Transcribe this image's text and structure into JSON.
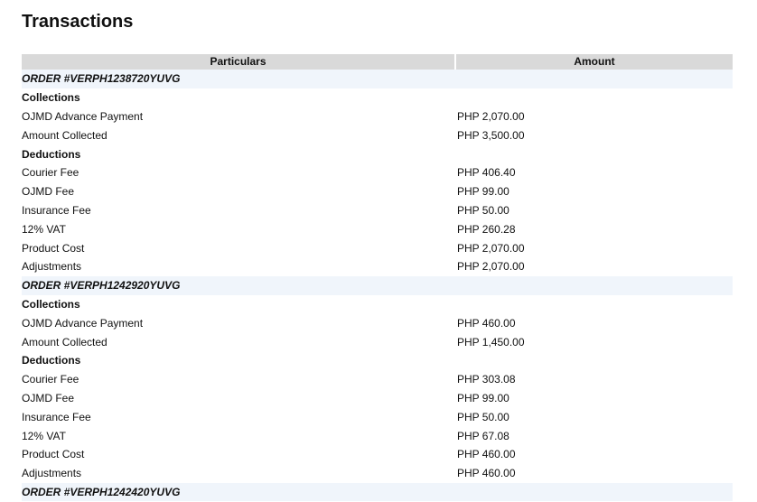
{
  "page": {
    "title": "Transactions"
  },
  "table": {
    "headers": {
      "particulars": "Particulars",
      "amount": "Amount"
    },
    "rows": [
      {
        "kind": "order",
        "label": "ORDER #VERPH1238720YUVG",
        "amount": ""
      },
      {
        "kind": "section",
        "label": "Collections",
        "amount": ""
      },
      {
        "kind": "item",
        "label": "OJMD Advance Payment",
        "amount": "PHP 2,070.00"
      },
      {
        "kind": "item",
        "label": "Amount Collected",
        "amount": "PHP 3,500.00"
      },
      {
        "kind": "section",
        "label": "Deductions",
        "amount": ""
      },
      {
        "kind": "item",
        "label": "Courier Fee",
        "amount": "PHP 406.40"
      },
      {
        "kind": "item",
        "label": "OJMD Fee",
        "amount": "PHP 99.00"
      },
      {
        "kind": "item",
        "label": "Insurance Fee",
        "amount": "PHP 50.00"
      },
      {
        "kind": "item",
        "label": "12% VAT",
        "amount": "PHP 260.28"
      },
      {
        "kind": "item",
        "label": "Product Cost",
        "amount": "PHP 2,070.00"
      },
      {
        "kind": "item",
        "label": "Adjustments",
        "amount": "PHP 2,070.00"
      },
      {
        "kind": "order",
        "label": "ORDER #VERPH1242920YUVG",
        "amount": ""
      },
      {
        "kind": "section",
        "label": "Collections",
        "amount": ""
      },
      {
        "kind": "item",
        "label": "OJMD Advance Payment",
        "amount": "PHP 460.00"
      },
      {
        "kind": "item",
        "label": "Amount Collected",
        "amount": "PHP 1,450.00"
      },
      {
        "kind": "section",
        "label": "Deductions",
        "amount": ""
      },
      {
        "kind": "item",
        "label": "Courier Fee",
        "amount": "PHP 303.08"
      },
      {
        "kind": "item",
        "label": "OJMD Fee",
        "amount": "PHP 99.00"
      },
      {
        "kind": "item",
        "label": "Insurance Fee",
        "amount": "PHP 50.00"
      },
      {
        "kind": "item",
        "label": "12% VAT",
        "amount": "PHP 67.08"
      },
      {
        "kind": "item",
        "label": "Product Cost",
        "amount": "PHP 460.00"
      },
      {
        "kind": "item",
        "label": "Adjustments",
        "amount": "PHP 460.00"
      },
      {
        "kind": "order",
        "label": "ORDER #VERPH1242420YUVG",
        "amount": ""
      }
    ]
  }
}
